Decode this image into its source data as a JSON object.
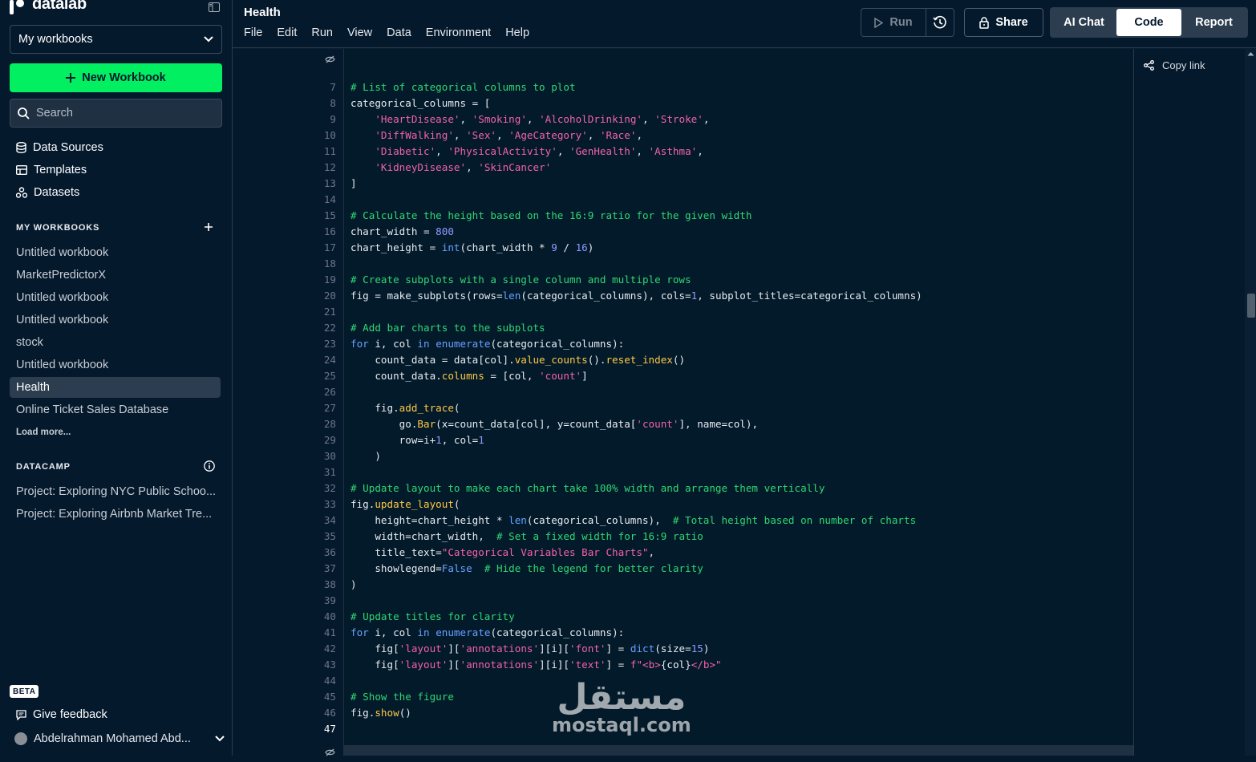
{
  "sidebar": {
    "logo_text": "datalab",
    "workspace_select": "My workbooks",
    "new_workbook": "New Workbook",
    "search_placeholder": "Search",
    "nav": [
      {
        "label": "Data Sources",
        "icon": "database-icon"
      },
      {
        "label": "Templates",
        "icon": "template-icon"
      },
      {
        "label": "Datasets",
        "icon": "dataset-icon"
      }
    ],
    "my_workbooks_title": "MY WORKBOOKS",
    "workbooks": [
      "Untitled workbook",
      "MarketPredictorX",
      "Untitled workbook",
      "Untitled workbook",
      "stock",
      "Untitled workbook",
      "Health",
      "Online Ticket Sales Database"
    ],
    "active_workbook": "Health",
    "load_more": "Load more...",
    "datacamp_title": "DATACAMP",
    "projects": [
      "Project: Exploring NYC Public Schoo...",
      "Project: Exploring Airbnb Market Tre..."
    ],
    "beta_badge": "BETA",
    "feedback": "Give feedback",
    "user_name": "Abdelrahman Mohamed Abd..."
  },
  "header": {
    "title": "Health",
    "menu": [
      "File",
      "Edit",
      "Run",
      "View",
      "Data",
      "Environment",
      "Help"
    ],
    "run_label": "Run",
    "share_label": "Share",
    "views": [
      "AI Chat",
      "Code",
      "Report"
    ],
    "active_view": "Code"
  },
  "right_pane": {
    "copy_link": "Copy link"
  },
  "editor": {
    "current_line": 47,
    "lines": [
      {
        "n": 7,
        "t": [
          [
            "c-com",
            "# List of categorical columns to plot"
          ]
        ]
      },
      {
        "n": 8,
        "t": [
          [
            "",
            "categorical_columns = ["
          ]
        ]
      },
      {
        "n": 9,
        "t": [
          [
            "",
            "    "
          ],
          [
            "c-str",
            "'HeartDisease'"
          ],
          [
            "",
            ", "
          ],
          [
            "c-str",
            "'Smoking'"
          ],
          [
            "",
            ", "
          ],
          [
            "c-str",
            "'AlcoholDrinking'"
          ],
          [
            "",
            ", "
          ],
          [
            "c-str",
            "'Stroke'"
          ],
          [
            "",
            ","
          ]
        ]
      },
      {
        "n": 10,
        "t": [
          [
            "",
            "    "
          ],
          [
            "c-str",
            "'DiffWalking'"
          ],
          [
            "",
            ", "
          ],
          [
            "c-str",
            "'Sex'"
          ],
          [
            "",
            ", "
          ],
          [
            "c-str",
            "'AgeCategory'"
          ],
          [
            "",
            ", "
          ],
          [
            "c-str",
            "'Race'"
          ],
          [
            "",
            ","
          ]
        ]
      },
      {
        "n": 11,
        "t": [
          [
            "",
            "    "
          ],
          [
            "c-str",
            "'Diabetic'"
          ],
          [
            "",
            ", "
          ],
          [
            "c-str",
            "'PhysicalActivity'"
          ],
          [
            "",
            ", "
          ],
          [
            "c-str",
            "'GenHealth'"
          ],
          [
            "",
            ", "
          ],
          [
            "c-str",
            "'Asthma'"
          ],
          [
            "",
            ","
          ]
        ]
      },
      {
        "n": 12,
        "t": [
          [
            "",
            "    "
          ],
          [
            "c-str",
            "'KidneyDisease'"
          ],
          [
            "",
            ", "
          ],
          [
            "c-str",
            "'SkinCancer'"
          ]
        ]
      },
      {
        "n": 13,
        "t": [
          [
            "",
            "]"
          ]
        ]
      },
      {
        "n": 14,
        "t": []
      },
      {
        "n": 15,
        "t": [
          [
            "c-com",
            "# Calculate the height based on the 16:9 ratio for the given width"
          ]
        ]
      },
      {
        "n": 16,
        "t": [
          [
            "",
            "chart_width = "
          ],
          [
            "c-num",
            "800"
          ]
        ]
      },
      {
        "n": 17,
        "t": [
          [
            "",
            "chart_height = "
          ],
          [
            "c-bi",
            "int"
          ],
          [
            "",
            "(chart_width * "
          ],
          [
            "c-num",
            "9"
          ],
          [
            "",
            " / "
          ],
          [
            "c-num",
            "16"
          ],
          [
            "",
            ")"
          ]
        ]
      },
      {
        "n": 18,
        "t": []
      },
      {
        "n": 19,
        "t": [
          [
            "c-com",
            "# Create subplots with a single column and multiple rows"
          ]
        ]
      },
      {
        "n": 20,
        "t": [
          [
            "",
            "fig = make_subplots(rows="
          ],
          [
            "c-bi",
            "len"
          ],
          [
            "",
            "(categorical_columns), cols="
          ],
          [
            "c-num",
            "1"
          ],
          [
            "",
            ", subplot_titles=categorical_columns)"
          ]
        ]
      },
      {
        "n": 21,
        "t": []
      },
      {
        "n": 22,
        "t": [
          [
            "c-com",
            "# Add bar charts to the subplots"
          ]
        ]
      },
      {
        "n": 23,
        "t": [
          [
            "c-kw",
            "for"
          ],
          [
            "",
            " i, col "
          ],
          [
            "c-kw",
            "in"
          ],
          [
            "",
            " "
          ],
          [
            "c-bi",
            "enumerate"
          ],
          [
            "",
            "(categorical_columns):"
          ]
        ]
      },
      {
        "n": 24,
        "t": [
          [
            "",
            "    count_data = data[col]."
          ],
          [
            "c-fn",
            "value_counts"
          ],
          [
            "",
            "()."
          ],
          [
            "c-fn",
            "reset_index"
          ],
          [
            "",
            "()"
          ]
        ]
      },
      {
        "n": 25,
        "t": [
          [
            "",
            "    count_data."
          ],
          [
            "c-fn",
            "columns"
          ],
          [
            "",
            " = [col, "
          ],
          [
            "c-str",
            "'count'"
          ],
          [
            "",
            "]"
          ]
        ]
      },
      {
        "n": 26,
        "t": []
      },
      {
        "n": 27,
        "t": [
          [
            "",
            "    fig."
          ],
          [
            "c-fn",
            "add_trace"
          ],
          [
            "",
            "("
          ]
        ]
      },
      {
        "n": 28,
        "t": [
          [
            "",
            "        go."
          ],
          [
            "c-fn",
            "Bar"
          ],
          [
            "",
            "(x=count_data[col], y=count_data["
          ],
          [
            "c-str",
            "'count'"
          ],
          [
            "",
            "], name=col),"
          ]
        ]
      },
      {
        "n": 29,
        "t": [
          [
            "",
            "        row=i+"
          ],
          [
            "c-num",
            "1"
          ],
          [
            "",
            ", col="
          ],
          [
            "c-num",
            "1"
          ]
        ]
      },
      {
        "n": 30,
        "t": [
          [
            "",
            "    )"
          ]
        ]
      },
      {
        "n": 31,
        "t": []
      },
      {
        "n": 32,
        "t": [
          [
            "c-com",
            "# Update layout to make each chart take 100% width and arrange them vertically"
          ]
        ]
      },
      {
        "n": 33,
        "t": [
          [
            "",
            "fig."
          ],
          [
            "c-fn",
            "update_layout"
          ],
          [
            "",
            "("
          ]
        ]
      },
      {
        "n": 34,
        "t": [
          [
            "",
            "    height=chart_height * "
          ],
          [
            "c-bi",
            "len"
          ],
          [
            "",
            "(categorical_columns),  "
          ],
          [
            "c-com",
            "# Total height based on number of charts"
          ]
        ]
      },
      {
        "n": 35,
        "t": [
          [
            "",
            "    width=chart_width,  "
          ],
          [
            "c-com",
            "# Set a fixed width for 16:9 ratio"
          ]
        ]
      },
      {
        "n": 36,
        "t": [
          [
            "",
            "    title_text="
          ],
          [
            "c-str",
            "\"Categorical Variables Bar Charts\""
          ],
          [
            "",
            ","
          ]
        ]
      },
      {
        "n": 37,
        "t": [
          [
            "",
            "    showlegend="
          ],
          [
            "c-bi",
            "False"
          ],
          [
            "",
            "  "
          ],
          [
            "c-com",
            "# Hide the legend for better clarity"
          ]
        ]
      },
      {
        "n": 38,
        "t": [
          [
            "",
            ")"
          ]
        ]
      },
      {
        "n": 39,
        "t": []
      },
      {
        "n": 40,
        "t": [
          [
            "c-com",
            "# Update titles for clarity"
          ]
        ]
      },
      {
        "n": 41,
        "t": [
          [
            "c-kw",
            "for"
          ],
          [
            "",
            " i, col "
          ],
          [
            "c-kw",
            "in"
          ],
          [
            "",
            " "
          ],
          [
            "c-bi",
            "enumerate"
          ],
          [
            "",
            "(categorical_columns):"
          ]
        ]
      },
      {
        "n": 42,
        "t": [
          [
            "",
            "    fig["
          ],
          [
            "c-str",
            "'layout'"
          ],
          [
            "",
            "]["
          ],
          [
            "c-str",
            "'annotations'"
          ],
          [
            "",
            "][i]["
          ],
          [
            "c-str",
            "'font'"
          ],
          [
            "",
            "] = "
          ],
          [
            "c-bi",
            "dict"
          ],
          [
            "",
            "(size="
          ],
          [
            "c-num",
            "15"
          ],
          [
            "",
            ")"
          ]
        ]
      },
      {
        "n": 43,
        "t": [
          [
            "",
            "    fig["
          ],
          [
            "c-str",
            "'layout'"
          ],
          [
            "",
            "]["
          ],
          [
            "c-str",
            "'annotations'"
          ],
          [
            "",
            "][i]["
          ],
          [
            "c-str",
            "'text'"
          ],
          [
            "",
            "] = "
          ],
          [
            "c-str",
            "f\"<b>"
          ],
          [
            "",
            "{col}"
          ],
          [
            "c-str",
            "</b>\""
          ]
        ]
      },
      {
        "n": 44,
        "t": []
      },
      {
        "n": 45,
        "t": [
          [
            "c-com",
            "# Show the figure"
          ]
        ]
      },
      {
        "n": 46,
        "t": [
          [
            "",
            "fig."
          ],
          [
            "c-fn",
            "show"
          ],
          [
            "",
            "()"
          ]
        ]
      },
      {
        "n": 47,
        "t": []
      }
    ]
  },
  "watermark": {
    "arabic": "مستقل",
    "latin": "mostaql.com"
  },
  "colors": {
    "accent_green": "#03ef62",
    "background": "#05192d"
  }
}
